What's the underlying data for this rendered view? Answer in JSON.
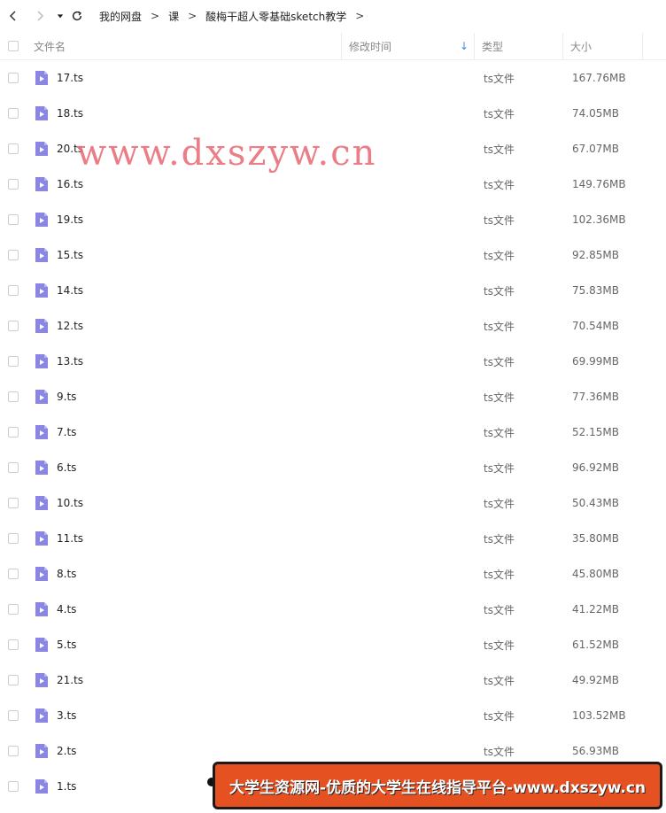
{
  "breadcrumb": [
    "我的网盘",
    "课",
    "酸梅干超人零基础sketch教学"
  ],
  "breadcrumb_separator": ">",
  "columns": {
    "name": "文件名",
    "modified": "修改时间",
    "type": "类型",
    "size": "大小"
  },
  "sort_icon": "arrow-down-icon",
  "files": [
    {
      "name": "17.ts",
      "type": "ts文件",
      "size": "167.76MB"
    },
    {
      "name": "18.ts",
      "type": "ts文件",
      "size": "74.05MB"
    },
    {
      "name": "20.ts",
      "type": "ts文件",
      "size": "67.07MB"
    },
    {
      "name": "16.ts",
      "type": "ts文件",
      "size": "149.76MB"
    },
    {
      "name": "19.ts",
      "type": "ts文件",
      "size": "102.36MB"
    },
    {
      "name": "15.ts",
      "type": "ts文件",
      "size": "92.85MB"
    },
    {
      "name": "14.ts",
      "type": "ts文件",
      "size": "75.83MB"
    },
    {
      "name": "12.ts",
      "type": "ts文件",
      "size": "70.54MB"
    },
    {
      "name": "13.ts",
      "type": "ts文件",
      "size": "69.99MB"
    },
    {
      "name": "9.ts",
      "type": "ts文件",
      "size": "77.36MB"
    },
    {
      "name": "7.ts",
      "type": "ts文件",
      "size": "52.15MB"
    },
    {
      "name": "6.ts",
      "type": "ts文件",
      "size": "96.92MB"
    },
    {
      "name": "10.ts",
      "type": "ts文件",
      "size": "50.43MB"
    },
    {
      "name": "11.ts",
      "type": "ts文件",
      "size": "35.80MB"
    },
    {
      "name": "8.ts",
      "type": "ts文件",
      "size": "45.80MB"
    },
    {
      "name": "4.ts",
      "type": "ts文件",
      "size": "41.22MB"
    },
    {
      "name": "5.ts",
      "type": "ts文件",
      "size": "61.52MB"
    },
    {
      "name": "21.ts",
      "type": "ts文件",
      "size": "49.92MB"
    },
    {
      "name": "3.ts",
      "type": "ts文件",
      "size": "103.52MB"
    },
    {
      "name": "2.ts",
      "type": "ts文件",
      "size": "56.93MB"
    },
    {
      "name": "1.ts",
      "type": "",
      "size": ""
    }
  ],
  "watermark": "www.dxszyw.cn",
  "banner": "大学生资源网-优质的大学生在线指导平台-www.dxszyw.cn",
  "colors": {
    "video_icon": "#8b86e6",
    "sort_arrow": "#3b8fe0",
    "watermark": "#e8707a",
    "banner_bg": "#e65122"
  }
}
